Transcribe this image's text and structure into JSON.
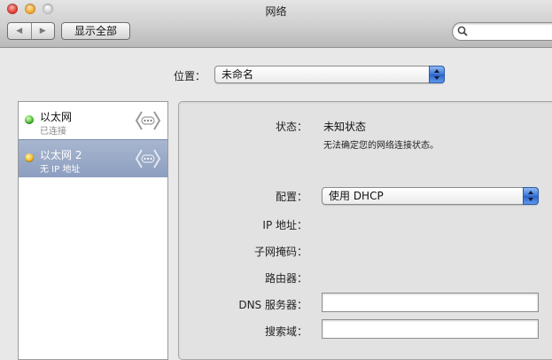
{
  "window": {
    "title": "网络"
  },
  "toolbar": {
    "back_icon": "back-arrow-icon",
    "forward_icon": "forward-arrow-icon",
    "show_all_label": "显示全部",
    "search": {
      "value": "",
      "placeholder": ""
    }
  },
  "location": {
    "label": "位置：",
    "value": "未命名"
  },
  "services": [
    {
      "name": "以太网",
      "status": "已连接",
      "status_color": "#45b82a",
      "selected": false
    },
    {
      "name": "以太网 2",
      "status": "无 IP 地址",
      "status_color": "#f0b41a",
      "selected": true
    }
  ],
  "details": {
    "status_label": "状态：",
    "status_value": "未知状态",
    "status_note": "无法确定您的网络连接状态。",
    "config_label": "配置：",
    "config_value": "使用 DHCP",
    "ip_label": "IP 地址：",
    "subnet_label": "子网掩码：",
    "router_label": "路由器：",
    "dns_label": "DNS 服务器：",
    "dns_value": "",
    "search_domain_label": "搜索域：",
    "search_domain_value": ""
  },
  "colors": {
    "selection": "#8c9ec0",
    "accent": "#3a75d6"
  }
}
